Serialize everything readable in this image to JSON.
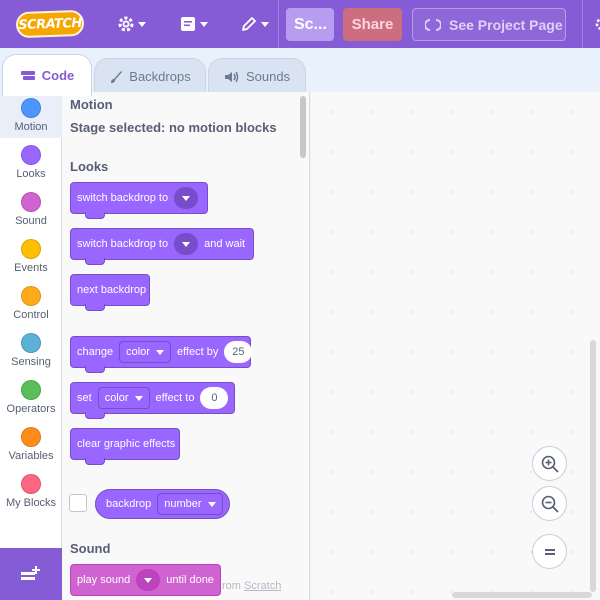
{
  "menubar": {
    "logo_text": "SCRATCH",
    "project_title": "Sc...",
    "share_label": "Share",
    "see_project_label": "See Project Page",
    "bg_color": "#855cd6"
  },
  "tabs": [
    {
      "label": "Code",
      "icon": "code-icon",
      "active": true
    },
    {
      "label": "Backdrops",
      "icon": "brush-icon",
      "active": false
    },
    {
      "label": "Sounds",
      "icon": "speaker-icon",
      "active": false
    }
  ],
  "categories": [
    {
      "label": "Motion",
      "color": "#4c97ff"
    },
    {
      "label": "Looks",
      "color": "#9966ff"
    },
    {
      "label": "Sound",
      "color": "#cf63cf"
    },
    {
      "label": "Events",
      "color": "#ffbf00"
    },
    {
      "label": "Control",
      "color": "#ffab19"
    },
    {
      "label": "Sensing",
      "color": "#5cb1d6"
    },
    {
      "label": "Operators",
      "color": "#59c059"
    },
    {
      "label": "Variables",
      "color": "#ff8c1a"
    },
    {
      "label": "My Blocks",
      "color": "#ff6680"
    }
  ],
  "flyout": {
    "motion_heading": "Motion",
    "motion_note": "Stage selected: no motion blocks",
    "looks_heading": "Looks",
    "sound_heading": "Sound",
    "blocks": {
      "switch_backdrop": "switch backdrop to",
      "switch_backdrop_wait_a": "switch backdrop to",
      "switch_backdrop_wait_b": "and wait",
      "next_backdrop": "next backdrop",
      "change_effect_a": "change",
      "change_effect_dd": "color",
      "change_effect_b": "effect by",
      "change_effect_val": "25",
      "set_effect_a": "set",
      "set_effect_dd": "color",
      "set_effect_b": "effect to",
      "set_effect_val": "0",
      "clear_effects": "clear graphic effects",
      "backdrop_reporter": "backdrop",
      "backdrop_reporter_dd": "number",
      "play_sound_a": "play sound",
      "play_sound_b": "until done"
    }
  },
  "workspace": {
    "watermark_a": "rom",
    "watermark_link": "Scratch"
  }
}
